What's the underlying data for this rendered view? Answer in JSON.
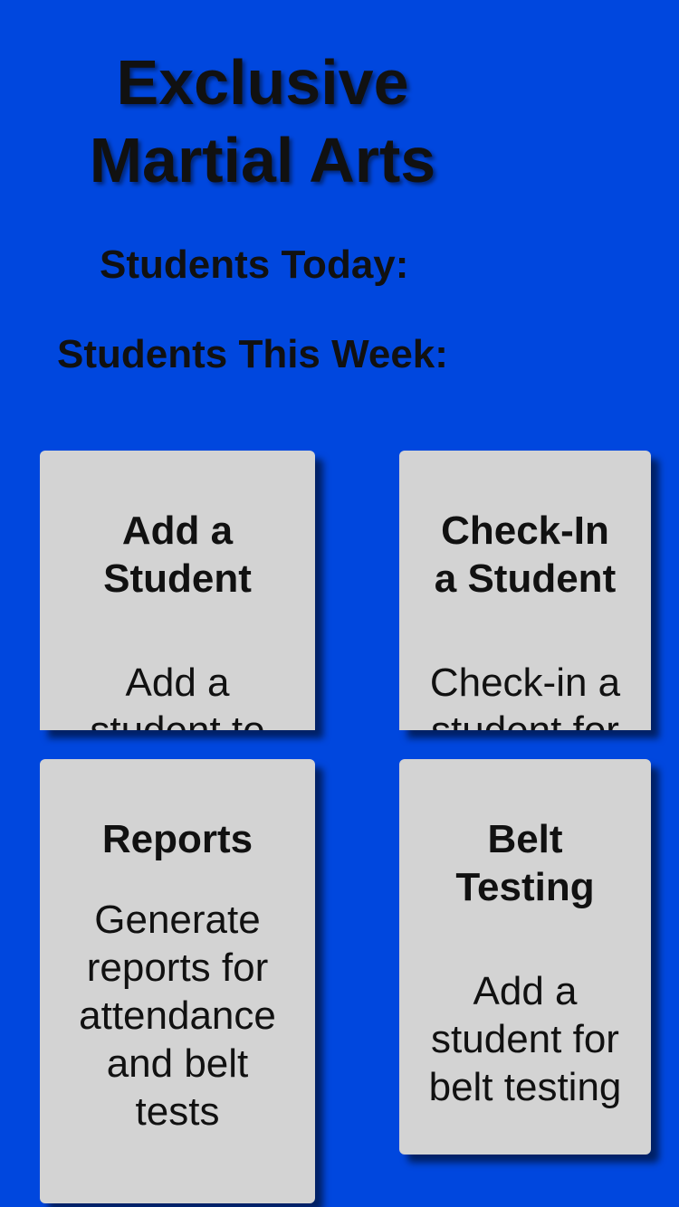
{
  "app": {
    "title_line1": "Exclusive",
    "title_line2": "Martial Arts"
  },
  "stats": {
    "today_label": "Students Today:",
    "week_label": "Students This Week:"
  },
  "cards": [
    {
      "title_line1": "Add a",
      "title_line2": "Student",
      "desc_line1": "Add a",
      "desc_line2": "student to"
    },
    {
      "title_line1": "Check-In",
      "title_line2": "a Student",
      "desc_line1": "Check-in a",
      "desc_line2": "student for"
    },
    {
      "title_line1": "Reports",
      "desc_line1": "Generate",
      "desc_line2": "reports for",
      "desc_line3": "attendance",
      "desc_line4": "and belt",
      "desc_line5": "tests"
    },
    {
      "title_line1": "Belt",
      "title_line2": "Testing",
      "desc_line1": "Add a",
      "desc_line2": "student for",
      "desc_line3": "belt testing"
    }
  ],
  "colors": {
    "background": "#0047de",
    "card": "#d3d3d3",
    "text": "#111111"
  }
}
